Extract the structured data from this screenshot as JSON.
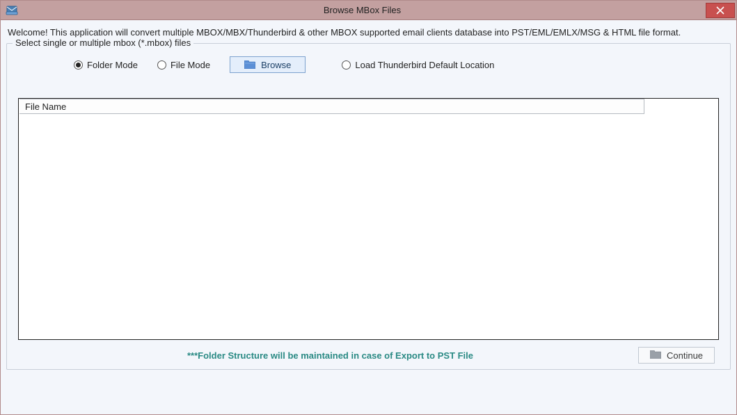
{
  "window": {
    "title": "Browse MBox Files"
  },
  "welcome": "Welcome! This application will convert multiple MBOX/MBX/Thunderbird & other MBOX supported email clients database into PST/EML/EMLX/MSG & HTML file format.",
  "fieldset": {
    "legend": "Select single or multiple mbox (*.mbox) files",
    "modes": {
      "folder": {
        "label": "Folder Mode",
        "selected": true
      },
      "file": {
        "label": "File Mode",
        "selected": false
      },
      "thunderbird": {
        "label": "Load Thunderbird Default Location",
        "selected": false
      }
    },
    "browse_label": "Browse"
  },
  "table": {
    "columns": {
      "filename": "File Name"
    },
    "rows": []
  },
  "footer": {
    "note": "***Folder Structure will be maintained in case of Export to PST File",
    "continue_label": "Continue"
  }
}
